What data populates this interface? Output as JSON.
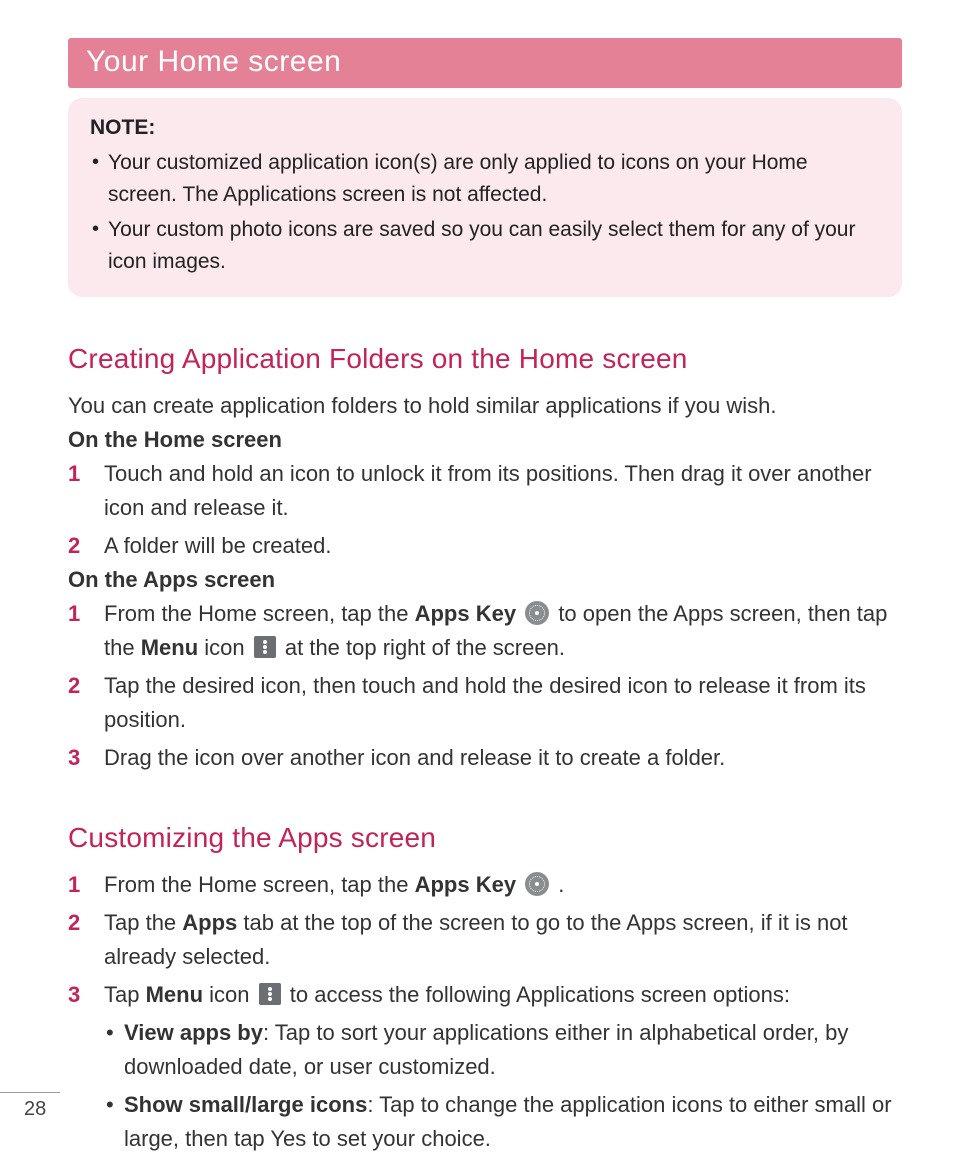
{
  "header": {
    "title": "Your Home screen"
  },
  "note": {
    "label": "NOTE:",
    "items": [
      "Your customized application icon(s) are only applied to icons on your Home screen. The Applications screen is not affected.",
      "Your custom photo icons are saved so you can easily select them for any of your icon images."
    ]
  },
  "section1": {
    "heading": "Creating Application Folders on the Home screen",
    "intro": "You can create application folders to hold similar applications if you wish.",
    "sub1_label": "On the Home screen",
    "home_steps": [
      "Touch and hold an icon to unlock it from its positions. Then drag it over another icon and release it.",
      "A folder will be created."
    ],
    "sub2_label": "On the Apps screen",
    "apps_step1_a": "From the Home screen, tap the ",
    "apps_step1_key": "Apps Key",
    "apps_step1_b": " to open the Apps screen, then tap the ",
    "apps_step1_menu": "Menu",
    "apps_step1_c": " icon ",
    "apps_step1_d": " at the top right of the screen.",
    "apps_step2": "Tap the desired icon, then touch and hold the desired icon to release it from its position.",
    "apps_step3": "Drag the icon over another icon and release it to create a folder."
  },
  "section2": {
    "heading": "Customizing the Apps screen",
    "step1_a": "From the Home screen, tap the ",
    "step1_key": "Apps Key",
    "step1_b": " .",
    "step2_a": "Tap the ",
    "step2_apps": "Apps",
    "step2_b": " tab at the top of the screen to go to the Apps screen, if it is not already selected.",
    "step3_a": "Tap ",
    "step3_menu": "Menu",
    "step3_b": " icon ",
    "step3_c": " to access the following Applications screen options:",
    "bullets": [
      {
        "label": "View apps by",
        "text": ": Tap to sort your applications either in alphabetical order, by downloaded date, or user customized."
      },
      {
        "label": "Show small/large icons",
        "text": ": Tap to change the application icons to either small or large, then tap Yes to set your choice."
      }
    ]
  },
  "page_number": "28"
}
